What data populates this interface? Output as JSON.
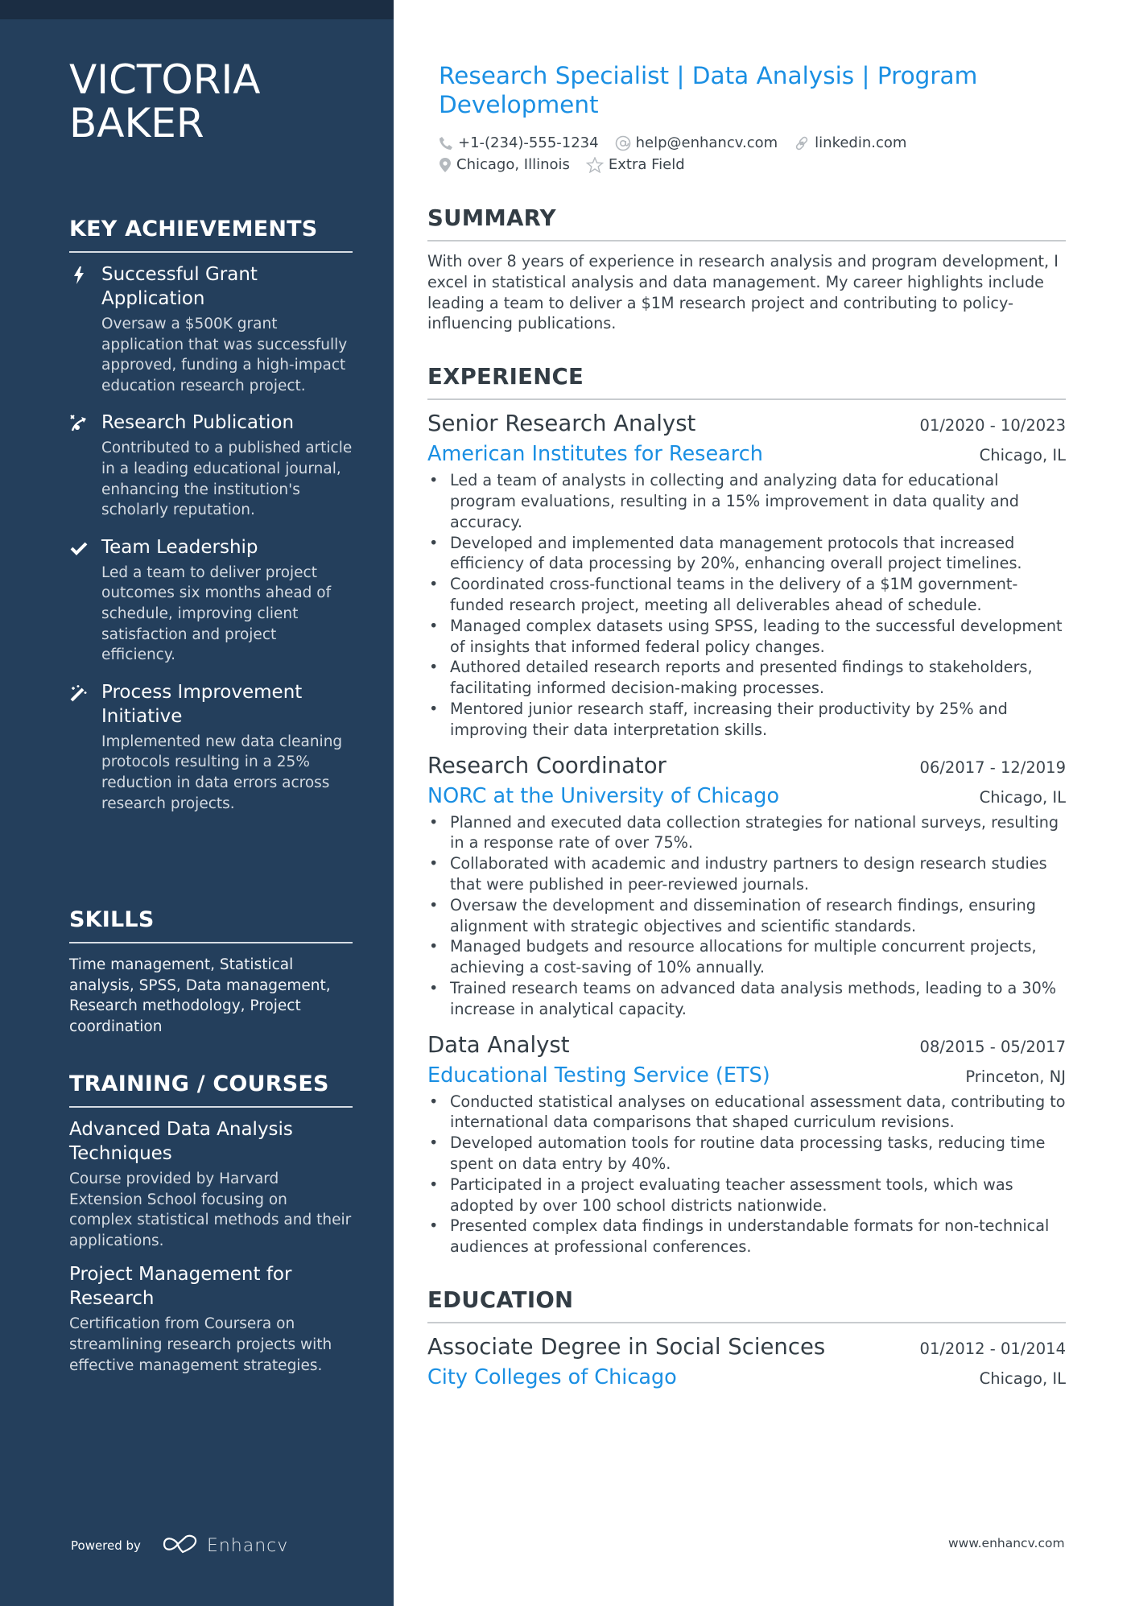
{
  "sidebar": {
    "name_line1": "VICTORIA",
    "name_line2": "BAKER",
    "achievements": {
      "title": "KEY ACHIEVEMENTS",
      "items": [
        {
          "icon": "lightning-bolt-icon",
          "title": "Successful Grant Application",
          "desc": "Oversaw a $500K grant application that was successfully approved, funding a high-impact education research project."
        },
        {
          "icon": "strategy-path-icon",
          "title": "Research Publication",
          "desc": "Contributed to a published article in a leading educational journal, enhancing the institution's scholarly reputation."
        },
        {
          "icon": "checkmark-icon",
          "title": "Team Leadership",
          "desc": "Led a team to deliver project outcomes six months ahead of schedule, improving client satisfaction and project efficiency."
        },
        {
          "icon": "magic-wand-icon",
          "title": "Process Improvement Initiative",
          "desc": "Implemented new data cleaning protocols resulting in a 25% reduction in data errors across research projects."
        }
      ]
    },
    "skills": {
      "title": "SKILLS",
      "text": "Time management, Statistical analysis, SPSS, Data management, Research methodology, Project coordination"
    },
    "training": {
      "title": "TRAINING / COURSES",
      "items": [
        {
          "title": "Advanced Data Analysis Techniques",
          "desc": "Course provided by Harvard Extension School focusing on complex statistical methods and their applications."
        },
        {
          "title": "Project Management for Research",
          "desc": "Certification from Coursera on streamlining research projects with effective management strategies."
        }
      ]
    },
    "footer": {
      "powered_by": "Powered by",
      "brand": "Enhancv"
    }
  },
  "header": {
    "headline": "Research Specialist | Data Analysis | Program Development",
    "contacts": {
      "phone": "+1-(234)-555-1234",
      "email": "help@enhancv.com",
      "link": "linkedin.com",
      "location": "Chicago, Illinois",
      "extra": "Extra Field"
    }
  },
  "summary": {
    "title": "SUMMARY",
    "text": "With over 8 years of experience in research analysis and program development, I excel in statistical analysis and data management. My career highlights include leading a team to deliver a $1M research project and contributing to policy-influencing publications."
  },
  "experience": {
    "title": "EXPERIENCE",
    "jobs": [
      {
        "title": "Senior Research Analyst",
        "dates": "01/2020 - 10/2023",
        "company": "American Institutes for Research",
        "location": "Chicago, IL",
        "bullets": [
          "Led a team of analysts in collecting and analyzing data for educational program evaluations, resulting in a 15% improvement in data quality and accuracy.",
          "Developed and implemented data management protocols that increased efficiency of data processing by 20%, enhancing overall project timelines.",
          "Coordinated cross-functional teams in the delivery of a $1M government-funded research project, meeting all deliverables ahead of schedule.",
          "Managed complex datasets using SPSS, leading to the successful development of insights that informed federal policy changes.",
          "Authored detailed research reports and presented findings to stakeholders, facilitating informed decision-making processes.",
          "Mentored junior research staff, increasing their productivity by 25% and improving their data interpretation skills."
        ]
      },
      {
        "title": "Research Coordinator",
        "dates": "06/2017 - 12/2019",
        "company": "NORC at the University of Chicago",
        "location": "Chicago, IL",
        "bullets": [
          "Planned and executed data collection strategies for national surveys, resulting in a response rate of over 75%.",
          "Collaborated with academic and industry partners to design research studies that were published in peer-reviewed journals.",
          "Oversaw the development and dissemination of research findings, ensuring alignment with strategic objectives and scientific standards.",
          "Managed budgets and resource allocations for multiple concurrent projects, achieving a cost-saving of 10% annually.",
          "Trained research teams on advanced data analysis methods, leading to a 30% increase in analytical capacity."
        ]
      },
      {
        "title": "Data Analyst",
        "dates": "08/2015 - 05/2017",
        "company": "Educational Testing Service (ETS)",
        "location": "Princeton, NJ",
        "bullets": [
          "Conducted statistical analyses on educational assessment data, contributing to international data comparisons that shaped curriculum revisions.",
          "Developed automation tools for routine data processing tasks, reducing time spent on data entry by 40%.",
          "Participated in a project evaluating teacher assessment tools, which was adopted by over 100 school districts nationwide.",
          "Presented complex data findings in understandable formats for non-technical audiences at professional conferences."
        ]
      }
    ]
  },
  "education": {
    "title": "EDUCATION",
    "items": [
      {
        "degree": "Associate Degree in Social Sciences",
        "dates": "01/2012 - 01/2014",
        "school": "City Colleges of Chicago",
        "location": "Chicago, IL"
      }
    ]
  },
  "footer": {
    "url": "www.enhancv.com"
  },
  "colors": {
    "sidebar_bg": "#243f5c",
    "sidebar_top_band": "#1b2d43",
    "accent_blue": "#1a8fe3",
    "text_dark": "#333d45"
  }
}
